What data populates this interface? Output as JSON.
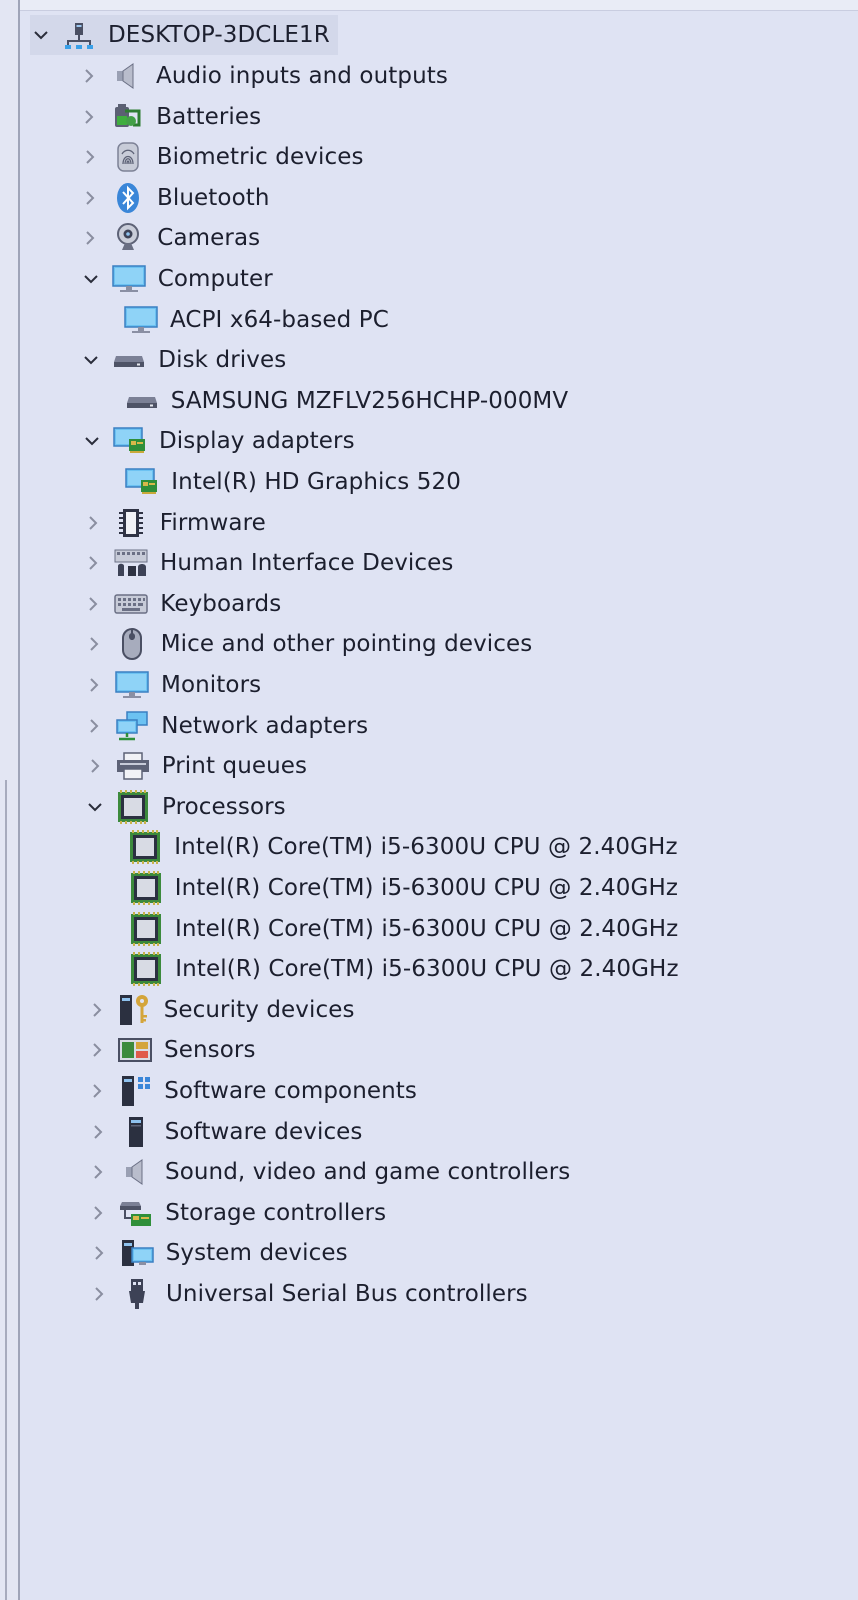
{
  "tree": {
    "root": {
      "label": "DESKTOP-3DCLE1R",
      "icon": "computer-network-icon"
    },
    "categories": [
      {
        "label": "Audio inputs and outputs",
        "icon": "speaker-icon",
        "expanded": false
      },
      {
        "label": "Batteries",
        "icon": "battery-icon",
        "expanded": false
      },
      {
        "label": "Biometric devices",
        "icon": "fingerprint-icon",
        "expanded": false
      },
      {
        "label": "Bluetooth",
        "icon": "bluetooth-icon",
        "expanded": false
      },
      {
        "label": "Cameras",
        "icon": "webcam-icon",
        "expanded": false
      },
      {
        "label": "Computer",
        "icon": "monitor-icon",
        "expanded": true
      },
      {
        "label": "ACPI x64-based PC",
        "icon": "monitor-icon",
        "child": true
      },
      {
        "label": "Disk drives",
        "icon": "disk-drive-icon",
        "expanded": true
      },
      {
        "label": "SAMSUNG MZFLV256HCHP-000MV",
        "icon": "disk-drive-icon",
        "child": true
      },
      {
        "label": "Display adapters",
        "icon": "display-adapter-icon",
        "expanded": true
      },
      {
        "label": "Intel(R) HD Graphics 520",
        "icon": "display-adapter-icon",
        "child": true
      },
      {
        "label": "Firmware",
        "icon": "firmware-chip-icon",
        "expanded": false
      },
      {
        "label": "Human Interface Devices",
        "icon": "hid-icon",
        "expanded": false
      },
      {
        "label": "Keyboards",
        "icon": "keyboard-icon",
        "expanded": false
      },
      {
        "label": "Mice and other pointing devices",
        "icon": "mouse-icon",
        "expanded": false
      },
      {
        "label": "Monitors",
        "icon": "monitor-icon",
        "expanded": false
      },
      {
        "label": "Network adapters",
        "icon": "network-adapter-icon",
        "expanded": false
      },
      {
        "label": "Print queues",
        "icon": "printer-icon",
        "expanded": false
      },
      {
        "label": "Processors",
        "icon": "processor-icon",
        "expanded": true
      },
      {
        "label": "Intel(R) Core(TM) i5-6300U CPU @ 2.40GHz",
        "icon": "processor-icon",
        "child": true
      },
      {
        "label": "Intel(R) Core(TM) i5-6300U CPU @ 2.40GHz",
        "icon": "processor-icon",
        "child": true
      },
      {
        "label": "Intel(R) Core(TM) i5-6300U CPU @ 2.40GHz",
        "icon": "processor-icon",
        "child": true
      },
      {
        "label": "Intel(R) Core(TM) i5-6300U CPU @ 2.40GHz",
        "icon": "processor-icon",
        "child": true
      },
      {
        "label": "Security devices",
        "icon": "security-key-icon",
        "expanded": false
      },
      {
        "label": "Sensors",
        "icon": "sensor-icon",
        "expanded": false
      },
      {
        "label": "Software components",
        "icon": "software-component-icon",
        "expanded": false
      },
      {
        "label": "Software devices",
        "icon": "software-device-icon",
        "expanded": false
      },
      {
        "label": "Sound, video and game controllers",
        "icon": "speaker-icon",
        "expanded": false
      },
      {
        "label": "Storage controllers",
        "icon": "storage-controller-icon",
        "expanded": false
      },
      {
        "label": "System devices",
        "icon": "system-devices-icon",
        "expanded": false
      },
      {
        "label": "Universal Serial Bus controllers",
        "icon": "usb-icon",
        "expanded": false
      }
    ]
  },
  "colors": {
    "background": "#dfe3f3",
    "text": "#1c1f2e",
    "chevron": "#8a8ea0",
    "icon_blue": "#3aa0e8",
    "chip_green": "#3c8a3c"
  }
}
